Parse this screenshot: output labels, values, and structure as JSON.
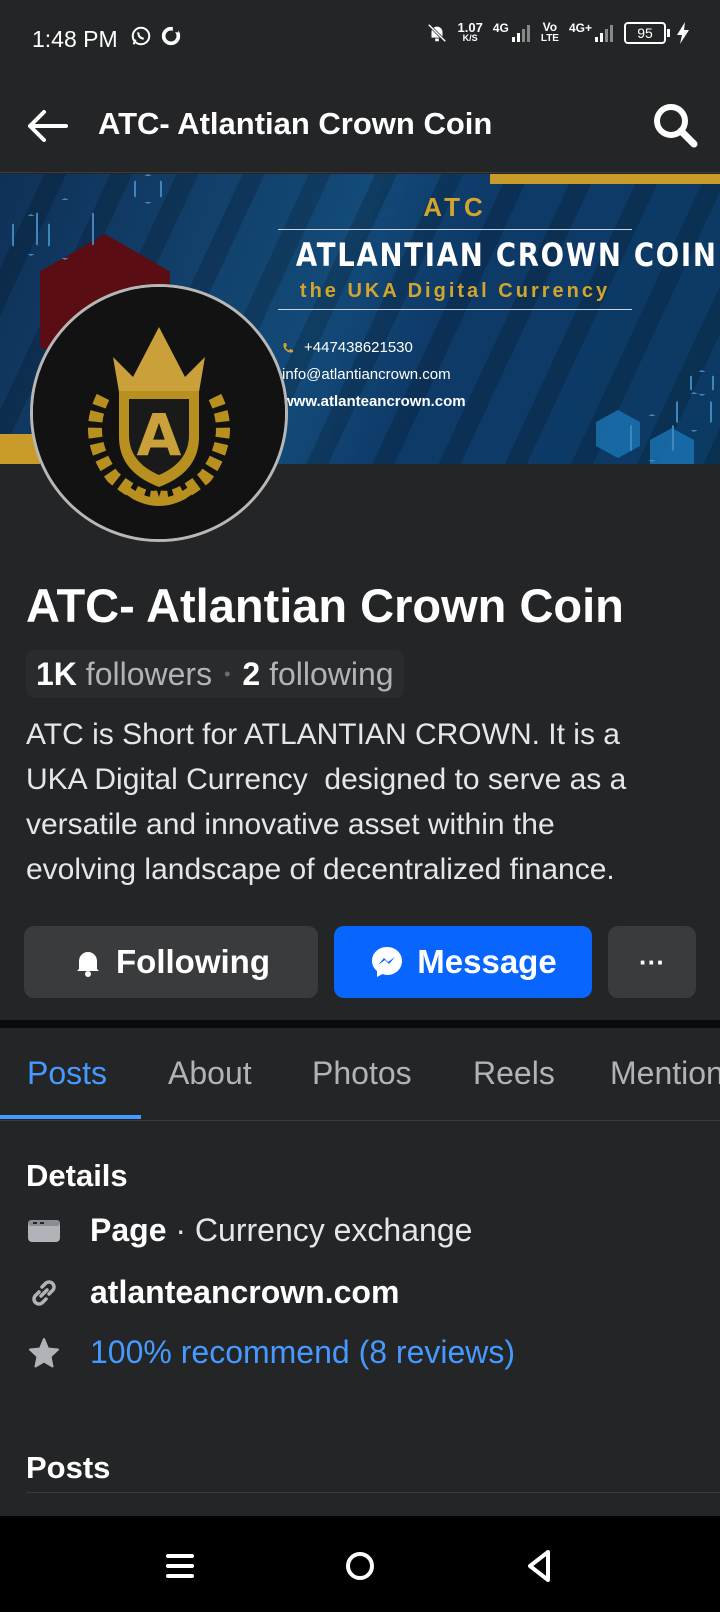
{
  "status_bar": {
    "time": "1:48 PM",
    "speed_value": "1.07",
    "speed_unit": "K/S",
    "net1": "4G",
    "volte_top": "Vo",
    "volte_bottom": "LTE",
    "net2": "4G+",
    "battery": "95"
  },
  "header": {
    "title": "ATC- Atlantian Crown Coin"
  },
  "cover": {
    "atc": "ATC",
    "name": "ATLANTIAN CROWN COIN",
    "subtitle": "the UKA Digital Currency",
    "phone": "+447438621530",
    "email": "info@atlantiancrown.com",
    "website": "www.atlanteancrown.com",
    "accent_gold": "#d4a52c"
  },
  "profile": {
    "name": "ATC- Atlantian Crown Coin",
    "followers_count": "1K",
    "followers_label": "followers",
    "following_count": "2",
    "following_label": "following",
    "bio": "ATC is Short for ATLANTIAN CROWN. It is a\nUKA Digital Currency  designed to serve as a\nversatile and innovative asset within the\nevolving landscape of decentralized finance."
  },
  "actions": {
    "following_label": "Following",
    "message_label": "Message",
    "more_label": "···"
  },
  "tabs": [
    "Posts",
    "About",
    "Photos",
    "Reels",
    "Mentions"
  ],
  "details": {
    "title": "Details",
    "page_label": "Page",
    "category": " · Currency exchange",
    "website": "atlanteancrown.com",
    "recommend": "100% recommend (8 reviews)"
  },
  "posts": {
    "title": "Posts"
  },
  "colors": {
    "background": "#242526",
    "primary": "#0866ff",
    "link": "#4599ff"
  }
}
